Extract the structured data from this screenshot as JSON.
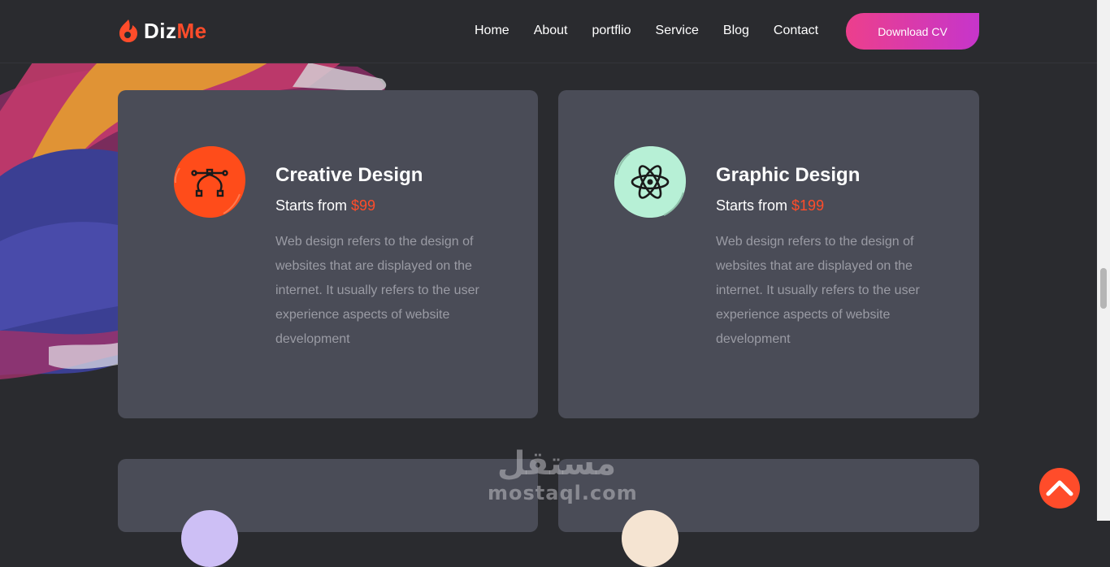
{
  "header": {
    "logo_text_1": "Diz",
    "logo_text_2": "Me",
    "nav": [
      "Home",
      "About",
      "portflio",
      "Service",
      "Blog",
      "Contact"
    ],
    "cta_label": "Download CV"
  },
  "services": [
    {
      "title": "Creative Design",
      "price_prefix": "Starts from",
      "price": "$99",
      "description": "Web design refers to the design of websites that are displayed on the internet. It usually refers to the user experience aspects of website development",
      "icon": "bezier-pen-icon",
      "icon_color": "#ff4c1a"
    },
    {
      "title": "Graphic Design",
      "price_prefix": "Starts from",
      "price": "$199",
      "description": "Web design refers to the design of websites that are displayed on the internet. It usually refers to the user experience aspects of website development",
      "icon": "atom-icon",
      "icon_color": "#b7f0d6"
    }
  ],
  "watermark": {
    "arabic": "مستقل",
    "latin": "mostaql.com"
  },
  "colors": {
    "accent": "#ff4c2a",
    "background": "#2a2b2f",
    "card": "#4a4c57",
    "button_gradient_start": "#ec3f8c",
    "button_gradient_end": "#c635cb"
  }
}
